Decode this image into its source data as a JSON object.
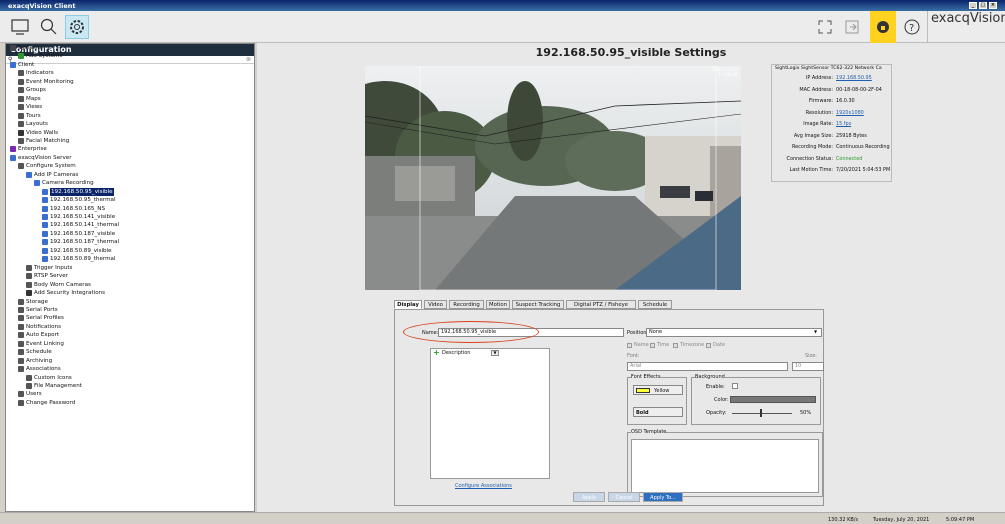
{
  "window": {
    "title": "exacqVision Client"
  },
  "brand": "exacqVision",
  "toolbar": {
    "icons": [
      "monitor-icon",
      "search-icon",
      "gear-icon",
      "fullscreen-icon",
      "exit-icon",
      "lock-icon",
      "help-icon"
    ]
  },
  "sidebar": {
    "title": "Configuration",
    "tree": [
      {
        "label": "Systems",
        "icon": "systems-icon"
      },
      {
        "label": "Add Systems",
        "icon": "add-icon"
      },
      {
        "label": "Client",
        "icon": "client-icon"
      },
      {
        "label": "Indicators",
        "icon": "indicator-icon"
      },
      {
        "label": "Event Monitoring",
        "icon": "event-icon"
      },
      {
        "label": "Groups",
        "icon": "groups-icon"
      },
      {
        "label": "Maps",
        "icon": "maps-icon"
      },
      {
        "label": "Views",
        "icon": "views-icon"
      },
      {
        "label": "Tours",
        "icon": "tours-icon"
      },
      {
        "label": "Layouts",
        "icon": "layouts-icon"
      },
      {
        "label": "Video Walls",
        "icon": "videowall-icon"
      },
      {
        "label": "Facial Matching",
        "icon": "face-icon"
      },
      {
        "label": "Enterprise",
        "icon": "enterprise-icon"
      },
      {
        "label": "exacqVision Server",
        "icon": "server-icon"
      },
      {
        "label": "Configure System",
        "icon": "system-icon"
      },
      {
        "label": "Add IP Cameras",
        "icon": "camera-icon"
      },
      {
        "label": "Camera Recording",
        "icon": "camera-icon"
      },
      {
        "label": "192.168.50.95_visible",
        "icon": "camera-icon"
      },
      {
        "label": "192.168.50.95_thermal",
        "icon": "camera-icon"
      },
      {
        "label": "192.168.50.165_NS",
        "icon": "camera-icon"
      },
      {
        "label": "192.168.50.141_visible",
        "icon": "camera-icon"
      },
      {
        "label": "192.168.50.141_thermal",
        "icon": "camera-icon"
      },
      {
        "label": "192.168.50.187_visible",
        "icon": "camera-icon"
      },
      {
        "label": "192.168.50.187_thermal",
        "icon": "camera-icon"
      },
      {
        "label": "192.168.50.89_visible",
        "icon": "camera-icon"
      },
      {
        "label": "192.168.50.89_thermal",
        "icon": "camera-icon"
      },
      {
        "label": "Trigger Inputs",
        "icon": "trigger-icon"
      },
      {
        "label": "RTSP Server",
        "icon": "rtsp-icon"
      },
      {
        "label": "Body Worn Cameras",
        "icon": "bodycam-icon"
      },
      {
        "label": "Add Security Integrations",
        "icon": "shield-icon"
      },
      {
        "label": "Storage",
        "icon": "storage-icon"
      },
      {
        "label": "Serial Ports",
        "icon": "serial-icon"
      },
      {
        "label": "Serial Profiles",
        "icon": "serial-icon"
      },
      {
        "label": "Notifications",
        "icon": "notification-icon"
      },
      {
        "label": "Auto Export",
        "icon": "export-icon"
      },
      {
        "label": "Event Linking",
        "icon": "link-icon"
      },
      {
        "label": "Schedule",
        "icon": "schedule-icon"
      },
      {
        "label": "Archiving",
        "icon": "archive-icon"
      },
      {
        "label": "Associations",
        "icon": "association-icon"
      },
      {
        "label": "Custom Icons",
        "icon": "custom-icon"
      },
      {
        "label": "File Management",
        "icon": "file-icon"
      },
      {
        "label": "Users",
        "icon": "user-icon"
      },
      {
        "label": "Change Password",
        "icon": "password-icon"
      }
    ]
  },
  "main": {
    "title": "192.168.50.95_visible Settings",
    "overlay_date": "2021/07/20",
    "overlay_time": "17:09:46",
    "info": {
      "device": "SightLogix SightSensor TC62-322 Network Ca",
      "rows": [
        {
          "k": "IP Address:",
          "v": "192.168.50.95",
          "link": true
        },
        {
          "k": "MAC Address:",
          "v": "00-18-08-00-2F-04"
        },
        {
          "k": "Firmware:",
          "v": "16.0.30"
        },
        {
          "k": "Resolution:",
          "v": "1920x1080",
          "link": true
        },
        {
          "k": "Image Rate:",
          "v": "15 fps",
          "link": true
        },
        {
          "k": "Avg Image Size:",
          "v": "25918 Bytes"
        },
        {
          "k": "Recording Mode:",
          "v": "Continuous Recording"
        },
        {
          "k": "Connection Status:",
          "v": "Connected",
          "green": true
        },
        {
          "k": "Last Motion Time:",
          "v": "7/20/2021 5:04:53 PM"
        }
      ]
    },
    "tabs": [
      "Display",
      "Video",
      "Recording",
      "Motion",
      "Suspect Tracking",
      "Digital PTZ / Fisheye",
      "Schedule"
    ],
    "display": {
      "name_label": "Name:",
      "name_value": "192.168.50.95_visible",
      "description_label": "Description",
      "configure_associations": "Configure Associations",
      "position_label": "Position:",
      "position_value": "None",
      "checks": [
        "Name",
        "Time",
        "Timezone",
        "Date"
      ],
      "font_label": "Font:",
      "font_value": "Arial",
      "size_label": "Size:",
      "size_value": "10",
      "font_effects_label": "Font Effects",
      "color_value": "Yellow",
      "style_value": "Bold",
      "background_label": "Background",
      "enable_label": "Enable:",
      "color_label": "Color:",
      "opacity_label": "Opacity:",
      "opacity_value": "50%",
      "osd_label": "OSD Template"
    },
    "buttons": {
      "apply": "Apply",
      "cancel": "Cancel",
      "apply_to": "Apply To..."
    }
  },
  "status": {
    "rate": "130.32 KB/s",
    "date": "Tuesday, July 20, 2021",
    "time": "5:09:47 PM"
  },
  "colors": {
    "accent": "#1f5fb0",
    "annotation": "#d9401d",
    "selected": "#0a246a",
    "connected": "#2a9a2a"
  }
}
